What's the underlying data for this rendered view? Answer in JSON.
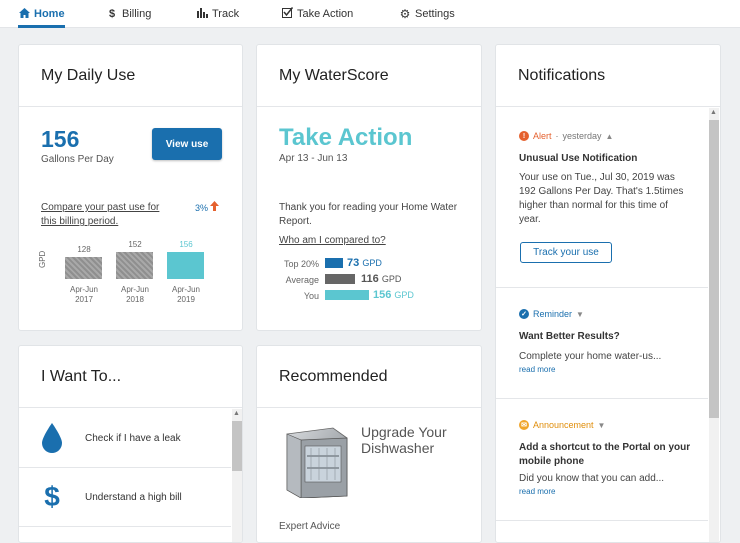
{
  "nav": {
    "items": [
      {
        "label": "Home",
        "icon": "home-icon"
      },
      {
        "label": "Billing",
        "icon": "dollar-icon"
      },
      {
        "label": "Track",
        "icon": "bar-chart-icon"
      },
      {
        "label": "Take Action",
        "icon": "checkbox-icon"
      },
      {
        "label": "Settings",
        "icon": "gear-icon"
      }
    ]
  },
  "daily_use": {
    "title": "My Daily Use",
    "value": "156",
    "unit_label": "Gallons Per Day",
    "view_button": "View use",
    "compare_link": "Compare your past use for this billing period.",
    "percent": "3%",
    "axis_label": "GPD"
  },
  "chart_data": {
    "type": "bar",
    "categories": [
      "Apr-Jun 2017",
      "Apr-Jun 2018",
      "Apr-Jun 2019"
    ],
    "values": [
      128,
      152,
      156
    ],
    "ylabel": "GPD",
    "highlight_color": "#5bc6d0",
    "base_color": "#9a9a9a"
  },
  "waterscore": {
    "title": "My WaterScore",
    "status": "Take Action",
    "date_range": "Apr 13 - Jun 13",
    "thanks": "Thank you for reading your Home Water Report.",
    "who_link": "Who am I compared to?",
    "comparison": [
      {
        "label": "Top 20%",
        "value": "73",
        "unit": "GPD",
        "color": "#1a6fae"
      },
      {
        "label": "Average",
        "value": "116",
        "unit": "GPD",
        "color": "#666666"
      },
      {
        "label": "You",
        "value": "156",
        "unit": "GPD",
        "color": "#5bc6d0"
      }
    ]
  },
  "notifications": {
    "title": "Notifications",
    "items": [
      {
        "type": "Alert",
        "time": "yesterday",
        "title": "Unusual Use Notification",
        "body": "Your use on Tue., Jul 30, 2019 was 192 Gallons Per Day. That's 1.5times higher than normal for this time of year.",
        "button": "Track your use"
      },
      {
        "type": "Reminder",
        "title": "Want Better Results?",
        "body": "Complete your home water-us...",
        "read_more": "read more"
      },
      {
        "type": "Announcement",
        "title": "Add a shortcut to the Portal on your mobile phone",
        "body": "Did you know that you can add...",
        "read_more": "read more"
      }
    ]
  },
  "want_to": {
    "title": "I Want To...",
    "items": [
      {
        "label": "Check if I have a leak",
        "icon": "water-drop-icon"
      },
      {
        "label": "Understand a high bill",
        "icon": "dollar-icon"
      }
    ]
  },
  "recommended": {
    "title": "Recommended",
    "item_title": "Upgrade Your Dishwasher",
    "category": "Expert Advice"
  },
  "colors": {
    "primary": "#1a6fae",
    "accent": "#5bc6d0",
    "alert": "#e5612e",
    "announcement": "#f0a52b"
  }
}
